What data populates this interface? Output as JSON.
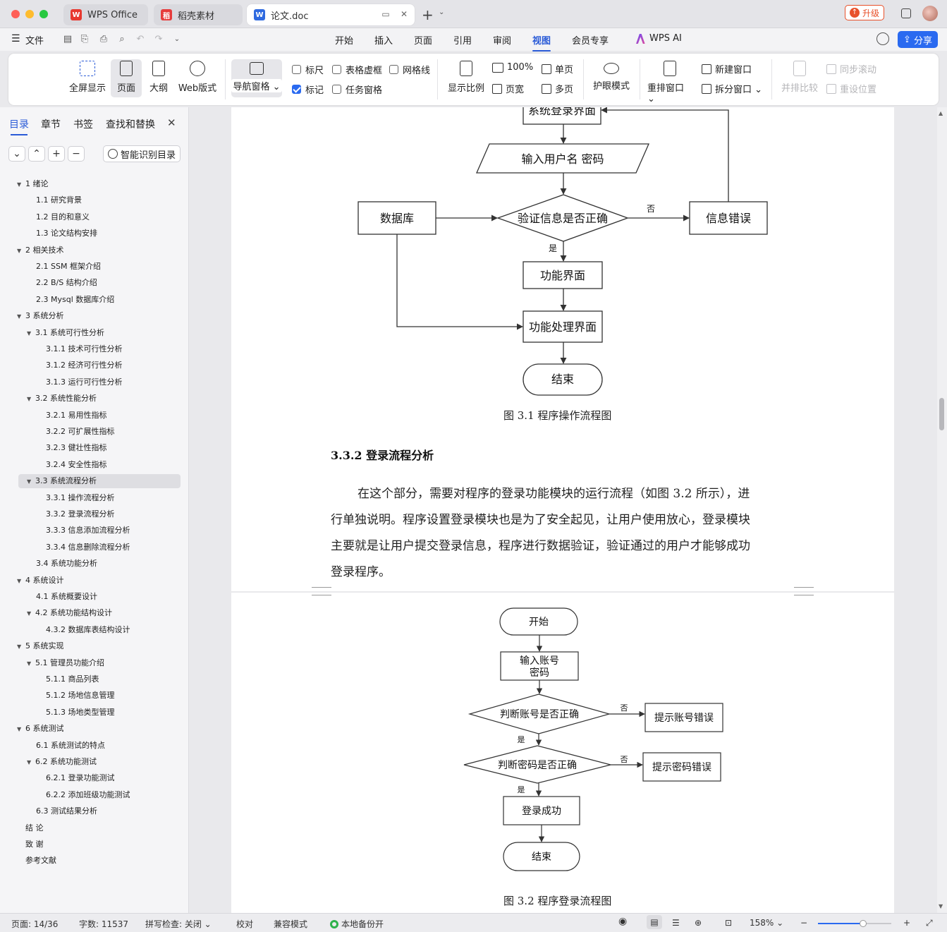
{
  "tabs": {
    "wps_home": "WPS Office",
    "daoke": "稻壳素材",
    "document": "论文.doc",
    "upgrade": "升级"
  },
  "menu": {
    "file": "文件",
    "items": [
      "开始",
      "插入",
      "页面",
      "引用",
      "审阅",
      "视图",
      "会员专享"
    ],
    "active": "视图",
    "wps_ai": "WPS AI",
    "share": "分享"
  },
  "ribbon": {
    "fullscreen": "全屏显示",
    "page": "页面",
    "outline": "大纲",
    "web": "Web版式",
    "nav_pane": "导航窗格",
    "ruler": "标尺",
    "table_dashes": "表格虚框",
    "gridlines": "网格线",
    "markup": "标记",
    "task_pane": "任务窗格",
    "zoom": "显示比例",
    "zoom_100": "100%",
    "page_width": "页宽",
    "single_page": "单页",
    "multi_page": "多页",
    "eye_care": "护眼模式",
    "rearrange": "重排窗口",
    "new_window": "新建窗口",
    "split_window": "拆分窗口",
    "side_by_side": "并排比较",
    "sync_scroll": "同步滚动",
    "reset_position": "重设位置"
  },
  "sidebar": {
    "tabs": [
      "目录",
      "章节",
      "书签",
      "查找和替换"
    ],
    "smart_toc": "智能识别目录",
    "toc": [
      {
        "label": "1  绪论",
        "level": 1,
        "arrow": true
      },
      {
        "label": "1.1  研究背景",
        "level": 2,
        "arrow": false
      },
      {
        "label": "1.2  目的和意义",
        "level": 2,
        "arrow": false
      },
      {
        "label": "1.3  论文结构安排",
        "level": 2,
        "arrow": false
      },
      {
        "label": "2  相关技术",
        "level": 1,
        "arrow": true
      },
      {
        "label": "2.1 SSM 框架介绍",
        "level": 2,
        "arrow": false
      },
      {
        "label": "2.2 B/S 结构介绍",
        "level": 2,
        "arrow": false
      },
      {
        "label": "2.3 Mysql 数据库介绍",
        "level": 2,
        "arrow": false
      },
      {
        "label": "3  系统分析",
        "level": 1,
        "arrow": true
      },
      {
        "label": "3.1  系统可行性分析",
        "level": 2,
        "arrow": true
      },
      {
        "label": "3.1.1  技术可行性分析",
        "level": 3,
        "arrow": false
      },
      {
        "label": "3.1.2  经济可行性分析",
        "level": 3,
        "arrow": false
      },
      {
        "label": "3.1.3  运行可行性分析",
        "level": 3,
        "arrow": false
      },
      {
        "label": "3.2  系统性能分析",
        "level": 2,
        "arrow": true
      },
      {
        "label": "3.2.1  易用性指标",
        "level": 3,
        "arrow": false
      },
      {
        "label": "3.2.2  可扩展性指标",
        "level": 3,
        "arrow": false
      },
      {
        "label": "3.2.3  健壮性指标",
        "level": 3,
        "arrow": false
      },
      {
        "label": "3.2.4  安全性指标",
        "level": 3,
        "arrow": false
      },
      {
        "label": "3.3  系统流程分析",
        "level": 2,
        "arrow": true,
        "selected": true
      },
      {
        "label": "3.3.1  操作流程分析",
        "level": 3,
        "arrow": false
      },
      {
        "label": "3.3.2  登录流程分析",
        "level": 3,
        "arrow": false
      },
      {
        "label": "3.3.3  信息添加流程分析",
        "level": 3,
        "arrow": false
      },
      {
        "label": "3.3.4  信息删除流程分析",
        "level": 3,
        "arrow": false
      },
      {
        "label": "3.4  系统功能分析",
        "level": 2,
        "arrow": false
      },
      {
        "label": "4  系统设计",
        "level": 1,
        "arrow": true
      },
      {
        "label": "4.1  系统概要设计",
        "level": 2,
        "arrow": false
      },
      {
        "label": "4.2  系统功能结构设计",
        "level": 2,
        "arrow": true
      },
      {
        "label": "4.3.2  数据库表结构设计",
        "level": 3,
        "arrow": false
      },
      {
        "label": "5  系统实现",
        "level": 1,
        "arrow": true
      },
      {
        "label": "5.1  管理员功能介绍",
        "level": 2,
        "arrow": true
      },
      {
        "label": "5.1.1  商品列表",
        "level": 3,
        "arrow": false
      },
      {
        "label": "5.1.2  场地信息管理",
        "level": 3,
        "arrow": false
      },
      {
        "label": "5.1.3 场地类型管理",
        "level": 3,
        "arrow": false
      },
      {
        "label": "6  系统测试",
        "level": 1,
        "arrow": true
      },
      {
        "label": "6.1  系统测试的特点",
        "level": 2,
        "arrow": false
      },
      {
        "label": "6.2  系统功能测试",
        "level": 2,
        "arrow": true
      },
      {
        "label": "6.2.1  登录功能测试",
        "level": 3,
        "arrow": false
      },
      {
        "label": "6.2.2  添加班级功能测试",
        "level": 3,
        "arrow": false
      },
      {
        "label": "6.3  测试结果分析",
        "level": 2,
        "arrow": false
      },
      {
        "label": "结    论",
        "level": 1,
        "arrow": false
      },
      {
        "label": "致    谢",
        "level": 1,
        "arrow": false
      },
      {
        "label": "参考文献",
        "level": 1,
        "arrow": false
      }
    ]
  },
  "document": {
    "fig1": {
      "nodes": {
        "login_ui": "系统登录界面",
        "input_user": "输入用户名 密码",
        "database": "数据库",
        "verify": "验证信息是否正确",
        "error": "信息错误",
        "function_ui": "功能界面",
        "process_ui": "功能处理界面",
        "end": "结束"
      },
      "no": "否",
      "yes": "是",
      "caption": "图 3.1  程序操作流程图"
    },
    "heading": "3.3.2  登录流程分析",
    "paragraph": [
      "在这个部分，需要对程序的登录功能模块的运行流程（如图 3.2 所示），进",
      "行单独说明。程序设置登录模块也是为了安全起见，让用户使用放心，登录模块",
      "主要就是让用户提交登录信息，程序进行数据验证，验证通过的用户才能够成功",
      "登录程序。"
    ],
    "fig2": {
      "nodes": {
        "start": "开始",
        "input_1": "输入账号",
        "input_2": "密码",
        "check_account": "判断账号是否正确",
        "account_error": "提示账号错误",
        "check_password": "判断密码是否正确",
        "password_error": "提示密码错误",
        "success": "登录成功",
        "end": "结束"
      },
      "no": "否",
      "yes": "是",
      "caption": "图 3.2  程序登录流程图"
    }
  },
  "status": {
    "page": "页面: 14/36",
    "words": "字数: 11537",
    "spell": "拼写检查: 关闭",
    "proof": "校对",
    "compat": "兼容模式",
    "backup": "本地备份开",
    "zoom": "158%"
  },
  "colors": {
    "accent": "#2a5bd7",
    "share_button": "#2a6af0",
    "upgrade": "#e8502a",
    "backup_ok": "#2fb24c"
  }
}
